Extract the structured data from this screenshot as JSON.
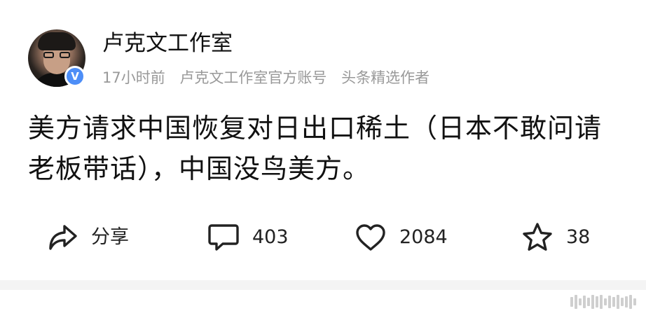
{
  "author": {
    "name": "卢克文工作室",
    "verified_mark": "V"
  },
  "meta": {
    "time": "17小时前",
    "account_type": "卢克文工作室官方账号",
    "tag": "头条精选作者"
  },
  "post": {
    "text": "美方请求中国恢复对日出口稀土（日本不敢问请老板带话），中国没鸟美方。"
  },
  "actions": {
    "share_label": "分享",
    "comment_count": "403",
    "like_count": "2084",
    "favorite_count": "38"
  },
  "icons": {
    "share": "share-arrow-icon",
    "comment": "comment-bubble-icon",
    "like": "heart-icon",
    "favorite": "star-icon"
  },
  "colors": {
    "verified_badge": "#4d8ef7",
    "meta_text": "#999999",
    "divider": "#f4f4f4"
  }
}
